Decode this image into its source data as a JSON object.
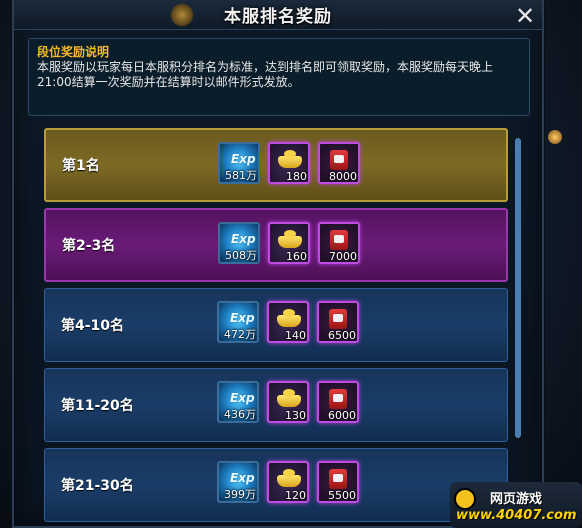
{
  "dialog": {
    "title": "本服排名奖励",
    "close_label": "✕"
  },
  "info": {
    "title": "段位奖励说明",
    "description": "本服奖励以玩家每日本服积分排名为标准，达到排名即可领取奖励，本服奖励每天晚上21:00结算一次奖励并在结算时以邮件形式发放。"
  },
  "ranks": [
    {
      "label": "第1名",
      "style": "gold",
      "exp": "581万",
      "ingot": "180",
      "box": "8000"
    },
    {
      "label": "第2-3名",
      "style": "purple",
      "exp": "508万",
      "ingot": "160",
      "box": "7000"
    },
    {
      "label": "第4-10名",
      "style": "blue",
      "exp": "472万",
      "ingot": "140",
      "box": "6500"
    },
    {
      "label": "第11-20名",
      "style": "blue",
      "exp": "436万",
      "ingot": "130",
      "box": "6000"
    },
    {
      "label": "第21-30名",
      "style": "blue",
      "exp": "399万",
      "ingot": "120",
      "box": "5500"
    }
  ],
  "icons": {
    "exp": "exp-icon",
    "exp_glyph": "Exp",
    "ingot": "gold-ingot-icon",
    "box": "red-gift-box-icon"
  },
  "logo": {
    "title": "网页游戏",
    "url": "www.40407.com"
  },
  "colors": {
    "gold_row": "#7d6a24",
    "purple_row": "#6a1b78",
    "blue_row": "#1a3d67",
    "info_title": "#f5b82a",
    "logo_url": "#ffd200"
  }
}
